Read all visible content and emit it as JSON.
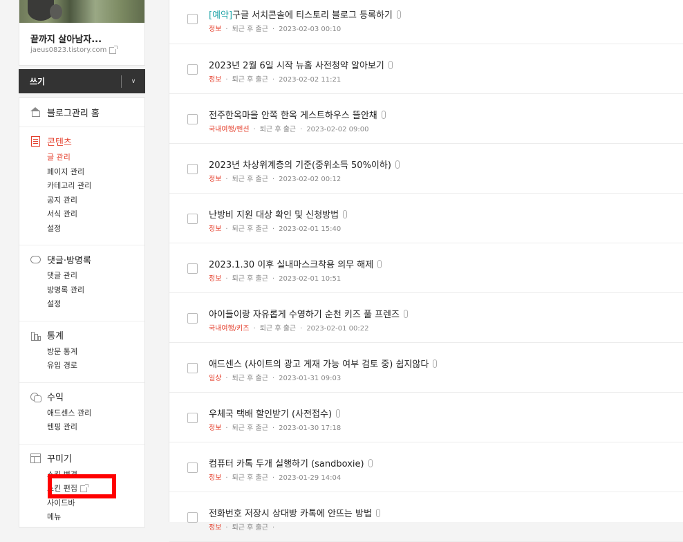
{
  "sidebar": {
    "blog_name": "끝까지 살아남자...",
    "blog_url": "jaeus0823.tistory.com",
    "write_label": "쓰기",
    "sections": {
      "home": {
        "title": "블로그관리 홈"
      },
      "contents": {
        "title": "콘텐츠",
        "items": [
          "글 관리",
          "페이지 관리",
          "카테고리 관리",
          "공지 관리",
          "서식 관리",
          "설정"
        ]
      },
      "comments": {
        "title": "댓글·방명록",
        "items": [
          "댓글 관리",
          "방명록 관리",
          "설정"
        ]
      },
      "stats": {
        "title": "통계",
        "items": [
          "방문 통계",
          "유입 경로"
        ]
      },
      "revenue": {
        "title": "수익",
        "items": [
          "애드센스 관리",
          "텐핑 관리"
        ]
      },
      "design": {
        "title": "꾸미기",
        "items": [
          "스킨 변경",
          "스킨 편집",
          "사이드바",
          "메뉴"
        ]
      }
    }
  },
  "posts": [
    {
      "prefix": "[예약]",
      "title": "구글 서치콘솔에 티스토리 블로그 등록하기",
      "category": "정보",
      "author": "퇴근 후 출근",
      "date": "2023-02-03 00:10"
    },
    {
      "prefix": "",
      "title": "2023년 2월 6일 시작 뉴홈 사전청약 알아보기",
      "category": "정보",
      "author": "퇴근 후 출근",
      "date": "2023-02-02 11:21"
    },
    {
      "prefix": "",
      "title": "전주한옥마을 안쪽 한옥 게스트하우스 뜰안채",
      "category": "국내여행/펜션",
      "author": "퇴근 후 출근",
      "date": "2023-02-02 09:00"
    },
    {
      "prefix": "",
      "title": "2023년 차상위계층의 기준(중위소득 50%이하)",
      "category": "정보",
      "author": "퇴근 후 출근",
      "date": "2023-02-02 00:12"
    },
    {
      "prefix": "",
      "title": "난방비 지원 대상 확인 및 신청방법",
      "category": "정보",
      "author": "퇴근 후 출근",
      "date": "2023-02-01 15:40"
    },
    {
      "prefix": "",
      "title": "2023.1.30 이후 실내마스크착용 의무 해제",
      "category": "정보",
      "author": "퇴근 후 출근",
      "date": "2023-02-01 10:51"
    },
    {
      "prefix": "",
      "title": "아이들이랑 자유롭게 수영하기 순천 키즈 풀 프렌즈",
      "category": "국내여행/키즈",
      "author": "퇴근 후 출근",
      "date": "2023-02-01 00:22"
    },
    {
      "prefix": "",
      "title": "애드센스 (사이트의 광고 게재 가능 여부 검토 중) 쉽지않다",
      "category": "일상",
      "author": "퇴근 후 출근",
      "date": "2023-01-31 09:03"
    },
    {
      "prefix": "",
      "title": "우체국 택배 할인받기 (사전접수)",
      "category": "정보",
      "author": "퇴근 후 출근",
      "date": "2023-01-30 17:18"
    },
    {
      "prefix": "",
      "title": "컴퓨터 카톡 두개 실행하기 (sandboxie)",
      "category": "정보",
      "author": "퇴근 후 출근",
      "date": "2023-01-29 14:04"
    },
    {
      "prefix": "",
      "title": "전화번호 저장시 상대방 카톡에 안뜨는 방법",
      "category": "정보",
      "author": "퇴근 후 출근",
      "date": ""
    }
  ],
  "colors": {
    "accent": "#e43e2b",
    "reserve": "#1fa4a8",
    "highlight": "#ff0000"
  }
}
